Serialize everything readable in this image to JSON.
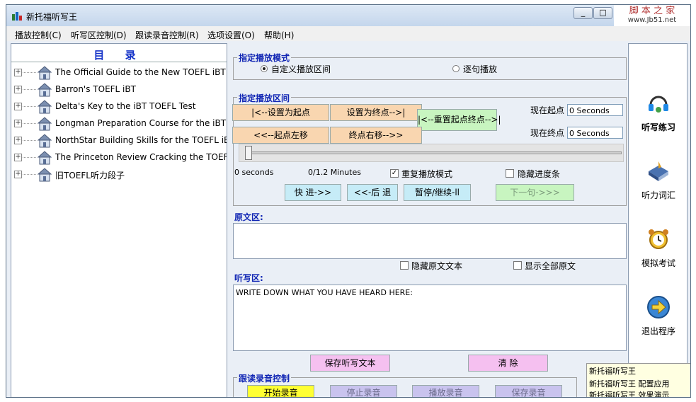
{
  "window": {
    "title": "新托福听写王",
    "minimize_label": "_",
    "maximize_label": "□",
    "close_label": "X"
  },
  "watermark": {
    "text": "脚 本 之 家",
    "sub": "www.Jb51.net"
  },
  "menubar": [
    "播放控制(C)",
    "听写区控制(D)",
    "跟读录音控制(R)",
    "选项设置(O)",
    "帮助(H)"
  ],
  "tree": {
    "title": "目 录",
    "items": [
      "The Official Guide to the New TOEFL iBT",
      "Barron's TOEFL iBT",
      "Delta's Key to the iBT TOEFL Test",
      "Longman Preparation Course for the iBT TOEFL",
      "NorthStar Building Skills for the TOEFL iBT",
      "The Princeton Review Cracking the TOEFL iBT",
      "旧TOEFL听力段子"
    ]
  },
  "mode": {
    "title": "指定播放模式",
    "option1": "自定义播放区间",
    "option2": "逐句播放",
    "selected": "自定义播放区间"
  },
  "range": {
    "title": "指定播放区间",
    "set_start": "|<--设置为起点",
    "set_end": "设置为终点-->|",
    "reset": "|<--重置起点终点-->|",
    "start_left": "<<--起点左移",
    "end_right": "终点右移-->>",
    "start_label": "现在起点",
    "end_label": "现在终点",
    "start_value": "0 Seconds",
    "end_value": "0 Seconds",
    "position": "0 seconds",
    "duration": "0/1.2 Minutes",
    "repeat_label": "重复播放模式",
    "repeat_checked": true,
    "hide_progress_label": "隐藏进度条",
    "hide_progress_checked": false,
    "forward": "快 进->>",
    "back": "<<-后 退",
    "pause": "暂停/继续-ll",
    "next": "下一句->>>",
    "progress": 0
  },
  "original": {
    "title": "原文区:",
    "text": "",
    "hide_label": "隐藏原文文本",
    "show_all_label": "显示全部原文"
  },
  "dictation": {
    "title": "听写区:",
    "placeholder": "WRITE DOWN WHAT YOU HAVE HEARD HERE:",
    "save": "保存听写文本",
    "clear": "清 除"
  },
  "record": {
    "title": "跟读录音控制",
    "start": "开始录音",
    "stop": "停止录音",
    "play": "播放录音",
    "save": "保存录音"
  },
  "right_panel": [
    {
      "label": "听写练习",
      "icon": "headset-icon",
      "active": true
    },
    {
      "label": "听力词汇",
      "icon": "book-icon",
      "active": false
    },
    {
      "label": "模拟考试",
      "icon": "alarm-clock-icon",
      "active": false
    },
    {
      "label": "退出程序",
      "icon": "exit-arrow-icon",
      "active": false
    }
  ],
  "balloon": {
    "line1": "新托福听写王",
    "line2": "新托福听写王 配置应用",
    "line3": "新托福听写王 效果演示"
  },
  "colors": {
    "group_title": "#1126b4",
    "tree_title": "#1533c8",
    "btn_peach": "#f9d6b0",
    "btn_green": "#c8f5c0",
    "btn_cyan": "#c6ecf7",
    "btn_pink": "#f5c0f0",
    "btn_yellow": "#ffff33",
    "btn_lavender": "#c9c3ee"
  }
}
